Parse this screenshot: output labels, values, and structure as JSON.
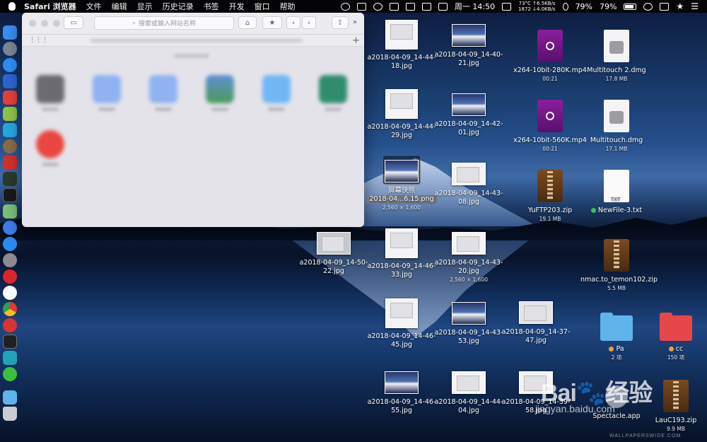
{
  "menubar": {
    "app_name": "Safari 浏览器",
    "menus": [
      "文件",
      "编辑",
      "显示",
      "历史记录",
      "书签",
      "开发",
      "窗口",
      "帮助"
    ],
    "clock": "周一 14:50",
    "temp": "73°C",
    "upload": "↑6.5KB/s",
    "fan": "1872",
    "download": "↓4.0KB/s",
    "battery_a": "79%",
    "battery_b": "79%"
  },
  "safari": {
    "address_placeholder": "搜索或输入网站名称",
    "add_tab": "+"
  },
  "desktop": {
    "col1": [
      {
        "name": "a2018-04-09_14-44-18.jpg"
      },
      {
        "name": "a2018-04-09_14-44-29.jpg"
      },
      {
        "name": "屏幕快照 2018-04...6.15.png",
        "line1": "屏幕快照",
        "line2": "2018-04...6.15.png",
        "sub": "2,560 × 1,600"
      },
      {
        "name": "a2018-04-09_14-46-33.jpg"
      },
      {
        "name": "a2018-04-09_14-46-45.jpg"
      },
      {
        "name": "a2018-04-09_14-46-55.jpg"
      }
    ],
    "col2": [
      {
        "name": "a2018-04-09_14-40-21.jpg"
      },
      {
        "name": "a2018-04-09_14-42-01.jpg"
      },
      {
        "name": "a2018-04-09_14-43-08.jpg"
      },
      {
        "name": "a2018-04-09_14-43-20.jpg",
        "sub": "2,560 × 1,600"
      },
      {
        "name": "a2018-04-09_14-43-53.jpg"
      },
      {
        "name": "a2018-04-09_14-44-04.jpg"
      }
    ],
    "col0": {
      "name": "a2018-04-09_14-50-22.jpg"
    },
    "col3": [
      {
        "name": "x264-10bit-280K.mp4",
        "sub": "00:21"
      },
      {
        "name": "x264-10bit-560K.mp4",
        "sub": "00:21"
      },
      {
        "name": "YuFTP203.zip",
        "sub": "19.1 MB"
      },
      {
        "name": "a2018-04-09_14-37-47.jpg"
      },
      {
        "name": "a2018-04-09_14-39-58.jpg"
      }
    ],
    "col4": [
      {
        "name": "Multitouch 2.dmg",
        "sub": "17.8 MB"
      },
      {
        "name": "Multitouch.dmg",
        "sub": "17.1 MB"
      },
      {
        "name": "NewFile-3.txt",
        "tag_color": "#3cc53c",
        "ext": "TXT"
      },
      {
        "name": "nmac.to_temon102.zip",
        "sub": "5.5 MB"
      },
      {
        "name": "Pa",
        "sub": "2 项",
        "tag_color": "#f0a030"
      },
      {
        "name": "Spectacle.app"
      }
    ],
    "col5": [
      {
        "name": "cc",
        "sub": "150 项",
        "tag_color": "#f0a030"
      },
      {
        "name": "LauC193.zip",
        "sub": "9.9 MB"
      }
    ]
  },
  "watermark": {
    "brand": "Bai",
    "brand2": "经验",
    "site": "jingyan.baidu.com",
    "credit": "WALLPAPERSWIDE.COM"
  },
  "colors": {
    "folder_blue": "#5fb4ea",
    "folder_red": "#e8474a"
  }
}
